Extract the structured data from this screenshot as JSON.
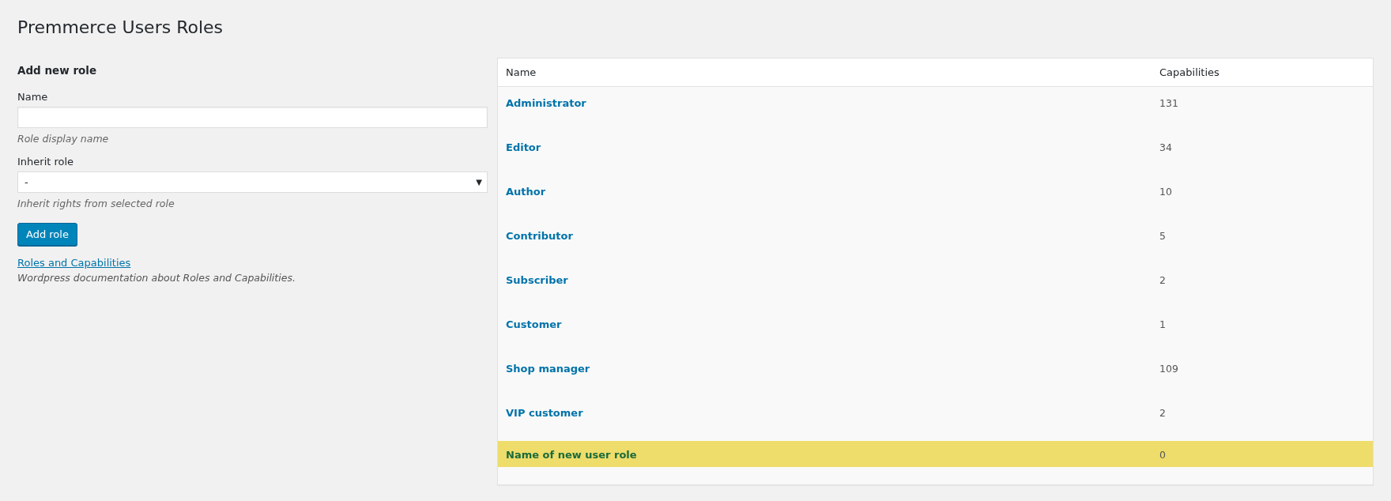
{
  "page": {
    "title": "Premmerce Users Roles"
  },
  "form": {
    "heading": "Add new role",
    "name_field": {
      "label": "Name",
      "hint": "Role display name"
    },
    "inherit_field": {
      "label": "Inherit role",
      "value": "-",
      "arrow": "▼",
      "hint": "Inherit rights from selected role"
    },
    "submit": "Add role",
    "doc_link": "Roles and Capabilities",
    "doc_text": "Wordpress documentation about Roles and Capabilities."
  },
  "table": {
    "columns": [
      "Name",
      "Capabilities"
    ],
    "rows": [
      {
        "name": "Administrator",
        "capabilities": "131",
        "highlighted": false
      },
      {
        "name": "Editor",
        "capabilities": "34",
        "highlighted": false
      },
      {
        "name": "Author",
        "capabilities": "10",
        "highlighted": false
      },
      {
        "name": "Contributor",
        "capabilities": "5",
        "highlighted": false
      },
      {
        "name": "Subscriber",
        "capabilities": "2",
        "highlighted": false
      },
      {
        "name": "Customer",
        "capabilities": "1",
        "highlighted": false
      },
      {
        "name": "Shop manager",
        "capabilities": "109",
        "highlighted": false
      },
      {
        "name": "VIP customer",
        "capabilities": "2",
        "highlighted": false
      },
      {
        "name": "Name of new user role",
        "capabilities": "0",
        "highlighted": true
      }
    ]
  }
}
